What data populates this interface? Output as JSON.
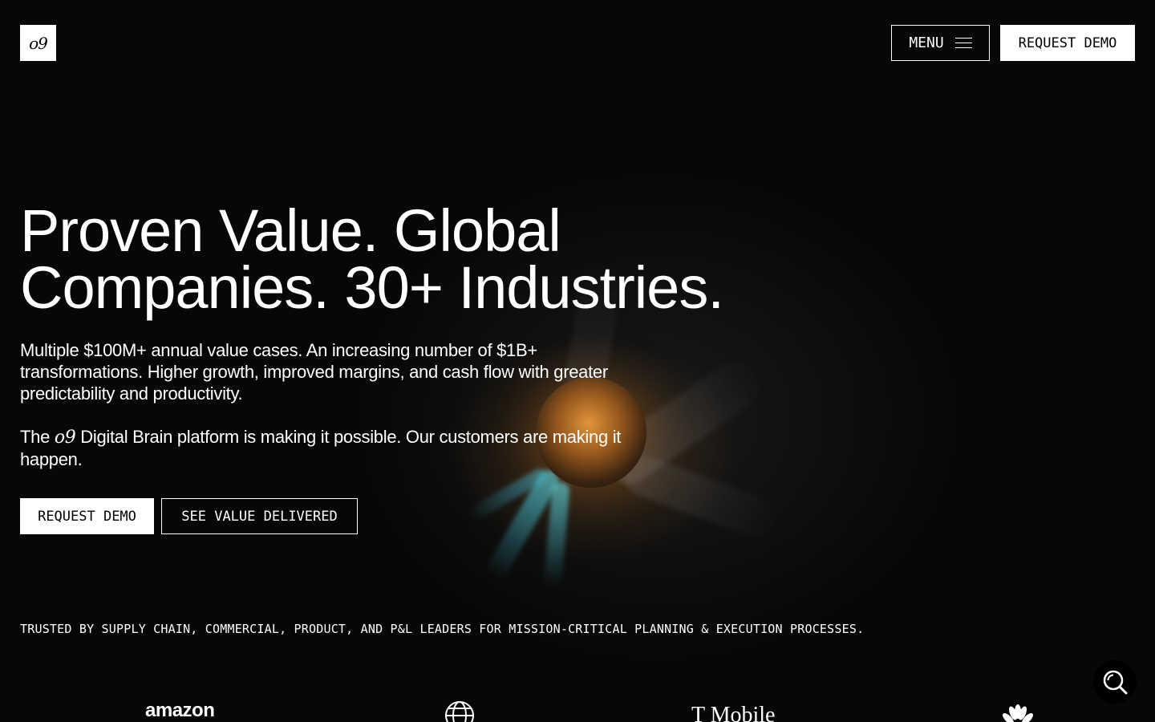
{
  "header": {
    "logo_text": "o9",
    "menu_label": "MENU",
    "request_demo_label": "REQUEST DEMO"
  },
  "hero": {
    "headline_line1": "Proven Value. Global",
    "headline_line2": "Companies. 30+ Industries.",
    "paragraph1": "Multiple $100M+ annual value cases. An increasing number of $1B+ transformations. Higher growth, improved margins, and cash flow with greater predictability and productivity.",
    "paragraph2_prefix": "The ",
    "paragraph2_brand": "o9",
    "paragraph2_suffix": " Digital Brain platform is making it possible. Our customers are making it happen.",
    "request_demo_label": "REQUEST DEMO",
    "see_value_label": "SEE VALUE DELIVERED"
  },
  "trusted_text": "TRUSTED BY SUPPLY CHAIN, COMMERCIAL, PRODUCT, AND P&L LEADERS FOR MISSION-CRITICAL PLANNING & EXECUTION PROCESSES.",
  "brands": {
    "amazon": "amazon",
    "tmobile": "T Mobile"
  },
  "icons": {
    "menu": "hamburger-icon",
    "search": "search-icon",
    "globe": "globe-logo-icon",
    "peacock": "peacock-logo-icon"
  }
}
